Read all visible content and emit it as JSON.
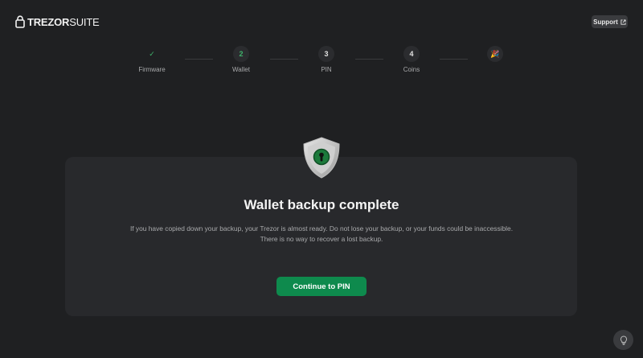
{
  "header": {
    "logo_brand": "TREZOR",
    "logo_product": "SUITE",
    "support_label": "Support"
  },
  "stepper": {
    "steps": [
      {
        "number": "✓",
        "label": "Firmware",
        "state": "done"
      },
      {
        "number": "2",
        "label": "Wallet",
        "state": "active"
      },
      {
        "number": "3",
        "label": "PIN",
        "state": "pending"
      },
      {
        "number": "4",
        "label": "Coins",
        "state": "pending"
      },
      {
        "number": "🎉",
        "label": "",
        "state": "pending"
      }
    ]
  },
  "card": {
    "title": "Wallet backup complete",
    "text": "If you have copied down your backup, your Trezor is almost ready. Do not lose your backup, or your funds could be inaccessible. There is no way to recover a lost backup.",
    "continue_label": "Continue to PIN"
  },
  "colors": {
    "background": "#1f2022",
    "card": "#28292c",
    "accent_green": "#0e8a4d",
    "check_green": "#3fb26b"
  }
}
